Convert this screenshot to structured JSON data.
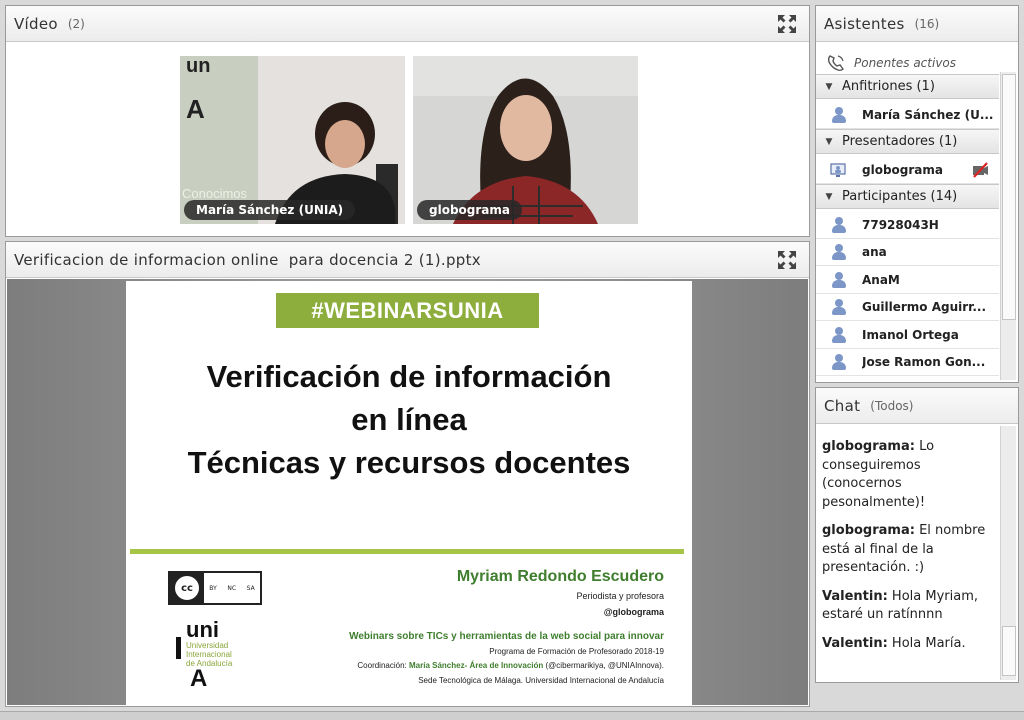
{
  "video_pod": {
    "title": "Vídeo",
    "count": "(2)",
    "tiles": [
      {
        "name": "María Sánchez (UNIA)"
      },
      {
        "name": "globograma"
      }
    ]
  },
  "share_pod": {
    "title": "Verificacion de informacion online  para docencia 2 (1).pptx",
    "slide": {
      "banner": "#WEBINARSUNIA",
      "title_line1": "Verificación de información",
      "title_line2": "en línea",
      "title_line3": "Técnicas y recursos docentes",
      "license_terms": [
        "BY",
        "NC",
        "SA"
      ],
      "author": "Myriam Redondo Escudero",
      "author_role": "Periodista y profesora",
      "author_handle": "@globograma",
      "series": "Webinars sobre TICs y herramientas de la web social para innovar",
      "program": "Programa de Formación de Profesorado 2018-19",
      "coordination_label": "Coordinación:",
      "coordination_name": "María Sánchez- Área de Innovación",
      "coordination_handles": "(@cibermarikiya, @UNIAInnova).",
      "venue": "Sede Tecnológica de Málaga. Universidad Internacional de Andalucía",
      "logo_line1": "uni",
      "logo_line2": "Universidad",
      "logo_line3": "Internacional",
      "logo_line4": "de Andalucía",
      "logo_letter": "A"
    }
  },
  "attendees_pod": {
    "title": "Asistentes",
    "count": "(16)",
    "active_presenters": "Ponentes activos",
    "groups": [
      {
        "label": "Anfitriones (1)",
        "members": [
          "María Sánchez (U..."
        ]
      },
      {
        "label": "Presentadores (1)",
        "members": [
          "globograma"
        ]
      },
      {
        "label": "Participantes (14)",
        "members": [
          "77928043H",
          "ana",
          "AnaM",
          "Guillermo Aguirr...",
          "Imanol Ortega",
          "Jose Ramon Gon..."
        ]
      }
    ]
  },
  "chat_pod": {
    "title": "Chat",
    "scope": "(Todos)",
    "messages": [
      {
        "sender": "globograma:",
        "text": "Lo conseguiremos (conocernos pesonalmente)!"
      },
      {
        "sender": "globograma:",
        "text": "El nombre está al final de la presentación. :)"
      },
      {
        "sender": "Valentin:",
        "text": "Hola Myriam, estaré un ratínnnn"
      },
      {
        "sender": "Valentin:",
        "text": "Hola María."
      }
    ]
  }
}
